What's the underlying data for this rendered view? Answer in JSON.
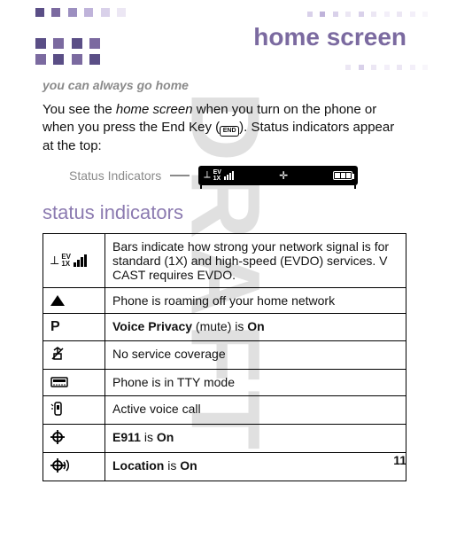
{
  "watermark": "DRAFT",
  "header": {
    "title": "home screen"
  },
  "subtitle": "you can always go home",
  "intro": {
    "pre": "You see the ",
    "term": "home screen",
    "mid": " when you turn on the phone or when you press the End Key (",
    "end_key_label": "END",
    "post": "). Status indicators appear at the top:"
  },
  "status_indicator_label": "Status Indicators",
  "section_heading": "status indicators",
  "table": {
    "rows": [
      {
        "icon": "signal",
        "text": "Bars indicate how strong your network signal is for standard (1X) and high-speed (EVDO) services. V CAST requires EVDO."
      },
      {
        "icon": "roam",
        "text": "Phone is roaming off your home network"
      },
      {
        "icon": "privacy",
        "bold_lead": "Voice Privacy",
        "mid": " (mute) is ",
        "bold_tail": "On"
      },
      {
        "icon": "noservice",
        "text": "No service coverage"
      },
      {
        "icon": "tty",
        "text": "Phone is in TTY mode"
      },
      {
        "icon": "call",
        "text": "Active voice call"
      },
      {
        "icon": "e911",
        "bold_lead": "E911",
        "mid": " is ",
        "bold_tail": "On"
      },
      {
        "icon": "location",
        "bold_lead": "Location",
        "mid": " is ",
        "bold_tail": "On"
      }
    ]
  },
  "page_number": "11"
}
